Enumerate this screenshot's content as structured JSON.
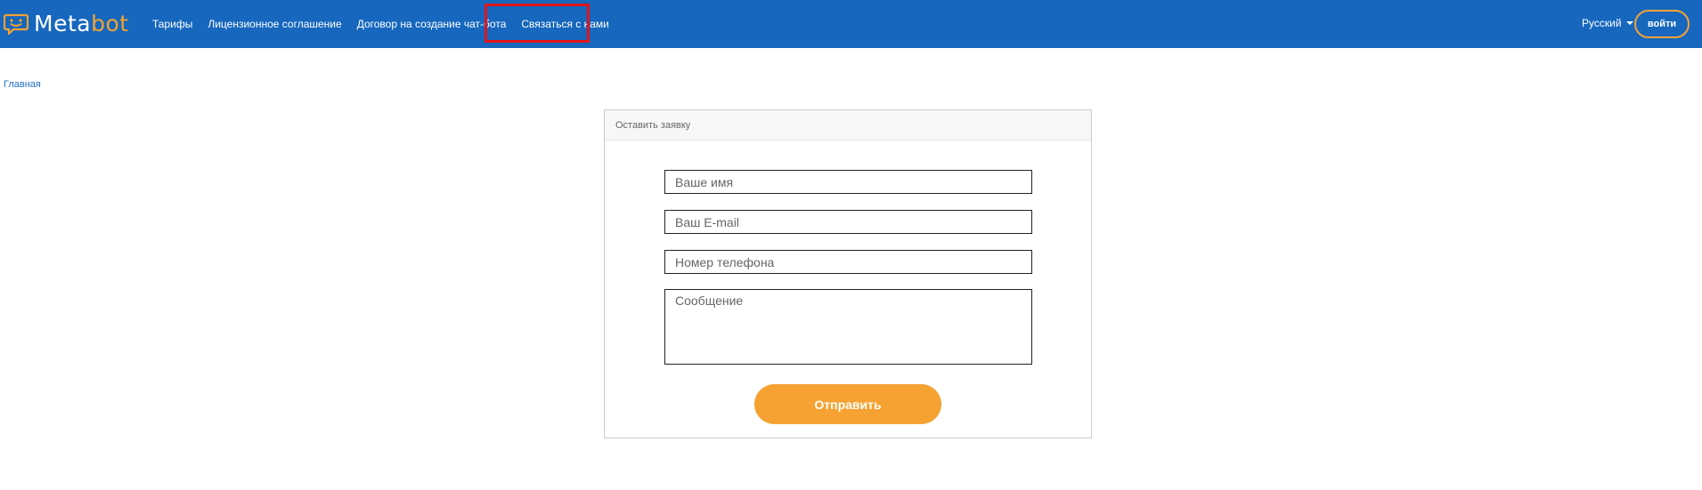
{
  "brand": {
    "name_part1": "Meta",
    "name_part2": "bot",
    "colors": {
      "primary": "#1667bd",
      "accent": "#f5a233",
      "highlight": "#e0141e"
    }
  },
  "nav": {
    "items": [
      {
        "label": "Тарифы"
      },
      {
        "label": "Лицензионное соглашение"
      },
      {
        "label": "Договор на создание чат-бота"
      },
      {
        "label": "Связаться с нами"
      }
    ],
    "language": "Русский",
    "login_label": "войти"
  },
  "breadcrumb": {
    "home": "Главная"
  },
  "form": {
    "title": "Оставить заявку",
    "name_placeholder": "Ваше имя",
    "email_placeholder": "Ваш E-mail",
    "phone_placeholder": "Номер телефона",
    "message_placeholder": "Сообщение",
    "submit_label": "Отправить"
  },
  "icons": {
    "logo": "chat-bubble-smile-icon",
    "language_caret": "caret-down-icon"
  }
}
